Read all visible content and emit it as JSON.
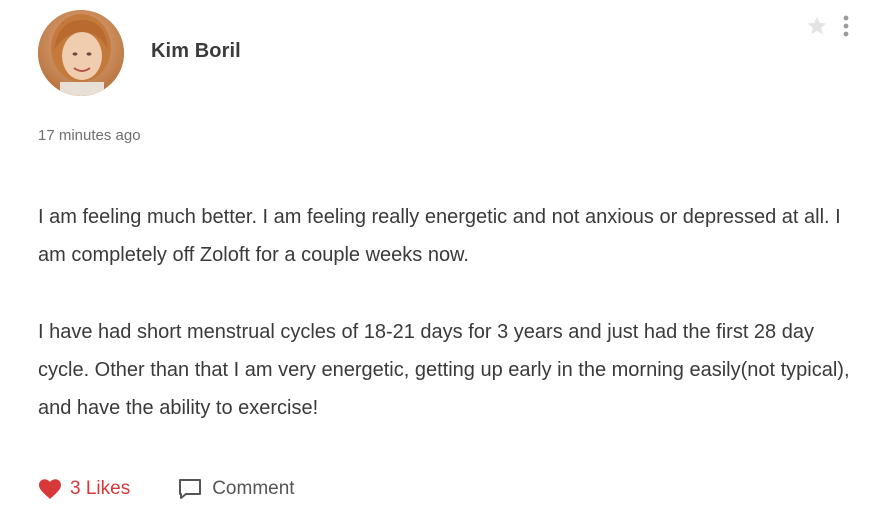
{
  "post": {
    "author": {
      "name": "Kim Boril",
      "avatar_icon": "user-avatar"
    },
    "timestamp": "17 minutes ago",
    "paragraphs": [
      "I am feeling much better. I am feeling really energetic and not anxious or depressed at all. I am completely off Zoloft for a couple weeks now.",
      "I have had short menstrual cycles of 18-21 days for 3 years and just had the first 28 day cycle. Other than that I am very energetic, getting up early in the morning easily(not typical), and have the ability to exercise!"
    ],
    "likes_label": "3 Likes",
    "comment_label": "Comment"
  },
  "icons": {
    "star": "star-icon",
    "more": "more-vertical-icon",
    "heart": "heart-icon",
    "comment": "comment-icon"
  },
  "colors": {
    "like": "#d93838",
    "text": "#3a3a3a",
    "muted": "#6f6f6f",
    "icon_gray": "#c8c8c8"
  }
}
